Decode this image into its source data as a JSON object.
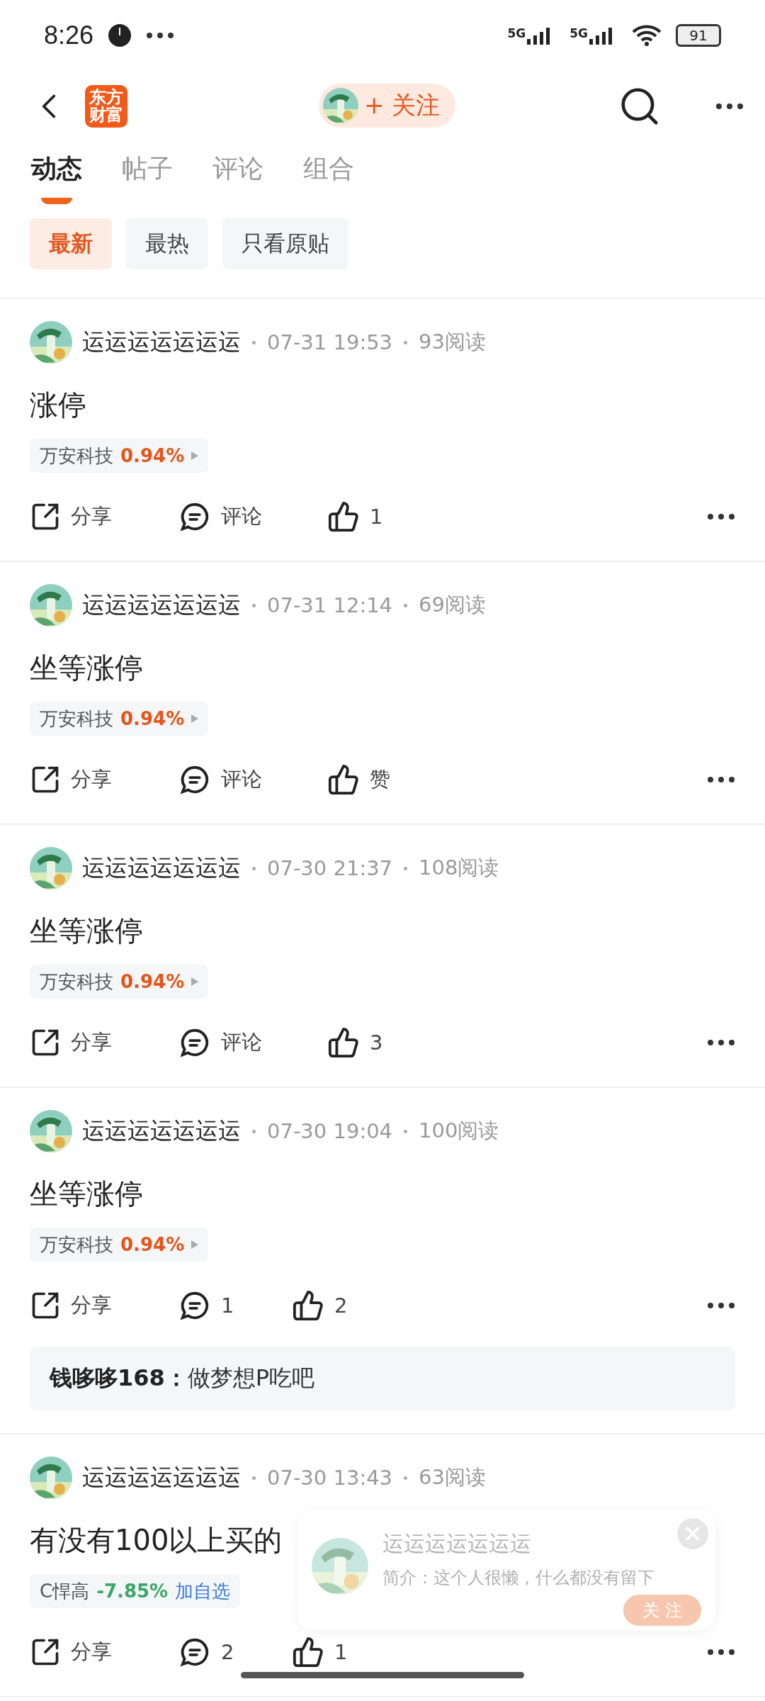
{
  "status_bar": {
    "time": "8:26",
    "networks": [
      "5G",
      "5G"
    ],
    "battery": "91"
  },
  "header": {
    "logo": "东方财富",
    "follow": "+ 关注"
  },
  "tabs": [
    {
      "label": "动态",
      "selected": true
    },
    {
      "label": "帖子",
      "selected": false
    },
    {
      "label": "评论",
      "selected": false
    },
    {
      "label": "组合",
      "selected": false
    }
  ],
  "filters": [
    {
      "label": "最新",
      "selected": true
    },
    {
      "label": "最热",
      "selected": false
    },
    {
      "label": "只看原贴",
      "selected": false
    }
  ],
  "posts": [
    {
      "author": "运运运运运运运",
      "time": "07-31 19:53",
      "reads": "93阅读",
      "content": "涨停",
      "stock": {
        "name": "万安科技",
        "change": "0.94%",
        "color": "#e4551b"
      },
      "share": "分享",
      "comment": "评论",
      "like": "1"
    },
    {
      "author": "运运运运运运运",
      "time": "07-31 12:14",
      "reads": "69阅读",
      "content": "坐等涨停",
      "stock": {
        "name": "万安科技",
        "change": "0.94%",
        "color": "#e4551b"
      },
      "share": "分享",
      "comment": "评论",
      "like": "赞"
    },
    {
      "author": "运运运运运运运",
      "time": "07-30 21:37",
      "reads": "108阅读",
      "content": "坐等涨停",
      "stock": {
        "name": "万安科技",
        "change": "0.94%",
        "color": "#e4551b"
      },
      "share": "分享",
      "comment": "评论",
      "like": "3"
    },
    {
      "author": "运运运运运运运",
      "time": "07-30 19:04",
      "reads": "100阅读",
      "content": "坐等涨停",
      "stock": {
        "name": "万安科技",
        "change": "0.94%",
        "color": "#e4551b"
      },
      "share": "分享",
      "comment": "1",
      "like": "2",
      "reply": {
        "user": "钱哆哆168：",
        "text": "做梦想P吃吧"
      }
    },
    {
      "author": "运运运运运运运",
      "time": "07-30 13:43",
      "reads": "63阅读",
      "content": "有没有100以上买的",
      "stock": {
        "name": "C悍高",
        "change": "-7.85%",
        "color": "#3aa86a",
        "add": "加自选"
      },
      "share": "分享",
      "comment": "2",
      "like": "1"
    }
  ],
  "popup": {
    "name": "运运运运运运运",
    "intro": "简介：这个人很懒，什么都没有留下",
    "follow": "关 注"
  }
}
